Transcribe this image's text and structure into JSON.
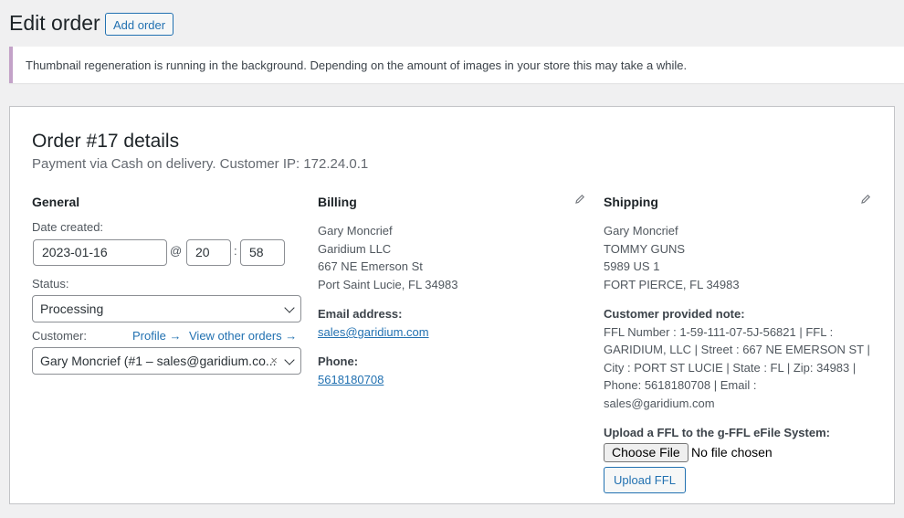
{
  "header": {
    "title": "Edit order",
    "add_order_label": "Add order"
  },
  "notice": {
    "text": "Thumbnail regeneration is running in the background. Depending on the amount of images in your store this may take a while."
  },
  "order": {
    "title": "Order #17 details",
    "subtitle": "Payment via Cash on delivery. Customer IP: 172.24.0.1"
  },
  "general": {
    "heading": "General",
    "date_label": "Date created:",
    "date_value": "2023-01-16",
    "at_sep": "@",
    "hour": "20",
    "time_sep": ":",
    "minute": "58",
    "status_label": "Status:",
    "status_value": "Processing",
    "customer_label": "Customer:",
    "profile_link": "Profile →",
    "other_orders_link": "View other orders →",
    "customer_value": "Gary Moncrief (#1 – sales@garidium.co...",
    "clear_symbol": "×"
  },
  "billing": {
    "heading": "Billing",
    "edit_icon": "pencil-icon",
    "address": [
      "Gary Moncrief",
      "Garidium LLC",
      "667 NE Emerson St",
      "Port Saint Lucie, FL 34983"
    ],
    "email_label": "Email address:",
    "email": "sales@garidium.com",
    "phone_label": "Phone:",
    "phone": "5618180708"
  },
  "shipping": {
    "heading": "Shipping",
    "edit_icon": "pencil-icon",
    "address": [
      "Gary Moncrief",
      "TOMMY GUNS",
      "5989 US 1",
      "FORT PIERCE, FL 34983"
    ],
    "note_label": "Customer provided note:",
    "note_lines": [
      "FFL Number : 1-59-111-07-5J-56821 | FFL :",
      "GARIDIUM, LLC | Street : 667 NE EMERSON ST |",
      "City : PORT ST LUCIE | State : FL | Zip: 34983 |",
      "Phone: 5618180708 | Email :",
      "sales@garidium.com"
    ],
    "upload_label": "Upload a FFL to the g-FFL eFile System:",
    "choose_file": "Choose File",
    "no_file": "No file chosen",
    "upload_button": "Upload FFL"
  },
  "colors": {
    "accent": "#2271b1",
    "notice_border": "#c3a2c8"
  }
}
